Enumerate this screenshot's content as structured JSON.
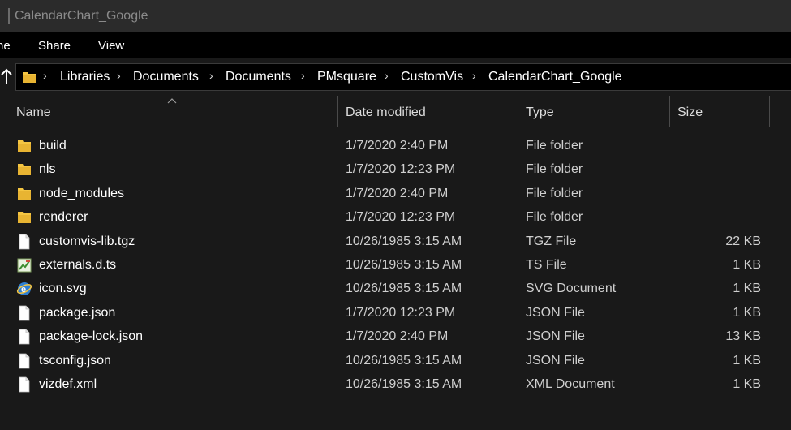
{
  "window": {
    "title": "CalendarChart_Google"
  },
  "ribbon": {
    "tabs": [
      "ne",
      "Share",
      "View"
    ]
  },
  "address": {
    "crumbs": [
      "Libraries",
      "Documents",
      "Documents",
      "PMsquare",
      "CustomVis",
      "CalendarChart_Google"
    ]
  },
  "columns": {
    "name": "Name",
    "date": "Date modified",
    "type": "Type",
    "size": "Size"
  },
  "files": [
    {
      "name": "build",
      "date": "1/7/2020 2:40 PM",
      "type": "File folder",
      "size": "",
      "icon": "folder-icon"
    },
    {
      "name": "nls",
      "date": "1/7/2020 12:23 PM",
      "type": "File folder",
      "size": "",
      "icon": "folder-icon"
    },
    {
      "name": "node_modules",
      "date": "1/7/2020 2:40 PM",
      "type": "File folder",
      "size": "",
      "icon": "folder-icon"
    },
    {
      "name": "renderer",
      "date": "1/7/2020 12:23 PM",
      "type": "File folder",
      "size": "",
      "icon": "folder-icon"
    },
    {
      "name": "customvis-lib.tgz",
      "date": "10/26/1985 3:15 AM",
      "type": "TGZ File",
      "size": "22 KB",
      "icon": "file-icon"
    },
    {
      "name": "externals.d.ts",
      "date": "10/26/1985 3:15 AM",
      "type": "TS File",
      "size": "1 KB",
      "icon": "ts-file-icon"
    },
    {
      "name": "icon.svg",
      "date": "10/26/1985 3:15 AM",
      "type": "SVG Document",
      "size": "1 KB",
      "icon": "browser-file-icon"
    },
    {
      "name": "package.json",
      "date": "1/7/2020 12:23 PM",
      "type": "JSON File",
      "size": "1 KB",
      "icon": "file-icon"
    },
    {
      "name": "package-lock.json",
      "date": "1/7/2020 2:40 PM",
      "type": "JSON File",
      "size": "13 KB",
      "icon": "file-icon"
    },
    {
      "name": "tsconfig.json",
      "date": "10/26/1985 3:15 AM",
      "type": "JSON File",
      "size": "1 KB",
      "icon": "file-icon"
    },
    {
      "name": "vizdef.xml",
      "date": "10/26/1985 3:15 AM",
      "type": "XML Document",
      "size": "1 KB",
      "icon": "file-icon"
    }
  ],
  "colors": {
    "background": "#191919",
    "titlebar": "#2b2b2b",
    "ribbon": "#000000",
    "folder": "#f4c542",
    "text": "#ffffff",
    "muted_text": "#cfcfcf"
  }
}
